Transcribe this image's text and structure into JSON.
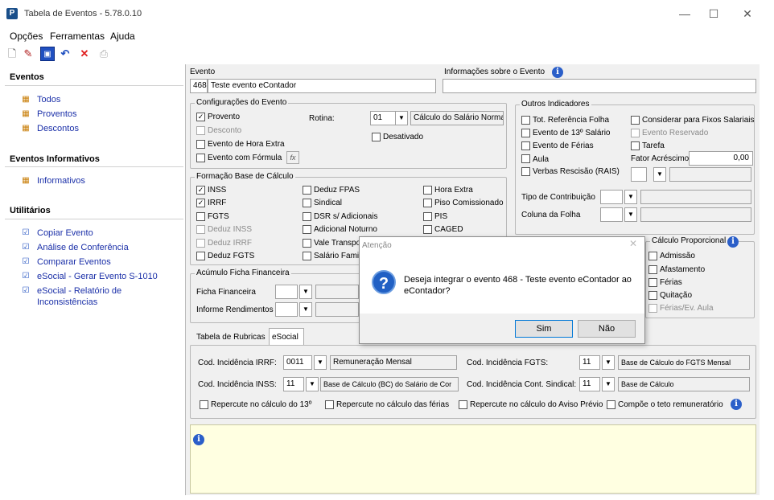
{
  "window": {
    "title": "Tabela de Eventos - 5.78.0.10",
    "minimize": "—",
    "maximize": "☐",
    "close": "✕"
  },
  "menu": [
    {
      "label": "Opções"
    },
    {
      "label": "Ferramentas"
    },
    {
      "label": "Ajuda"
    }
  ],
  "sidebar": {
    "eventos_title": "Eventos",
    "eventos": [
      "Todos",
      "Proventos",
      "Descontos"
    ],
    "informativos_title": "Eventos Informativos",
    "informativos": [
      "Informativos"
    ],
    "utilitarios_title": "Utilitários",
    "utilitarios": [
      "Copiar Evento",
      "Análise de Conferência",
      "Comparar Eventos",
      "eSocial - Gerar Evento S-1010",
      "eSocial - Relatório de",
      "Inconsistências"
    ]
  },
  "evento": {
    "label": "Evento",
    "code": "468",
    "name": "Teste evento eContador",
    "info_label": "Informações sobre o Evento",
    "info_value": ""
  },
  "config": {
    "title": "Configurações do Evento",
    "provento": "Provento",
    "desconto": "Desconto",
    "hora_extra": "Evento de Hora Extra",
    "formula": "Evento com Fórmula",
    "rotina_label": "Rotina:",
    "rotina_code": "01",
    "rotina_desc": "Cálculo do Salário Norma",
    "desativado": "Desativado",
    "fx": "fx"
  },
  "outros": {
    "title": "Outros Indicadores",
    "items": [
      "Tot. Referência Folha",
      "Evento de 13º Salário",
      "Evento de Férias",
      "Aula",
      "Verbas Rescisão (RAIS)"
    ],
    "right": [
      "Considerar para Fixos Salariais",
      "Evento Reservado",
      "Tarefa"
    ],
    "fator_label": "Fator Acréscimo",
    "fator_value": "0,00",
    "tipo_contrib": "Tipo de Contribuição",
    "coluna_folha": "Coluna da Folha"
  },
  "formacao": {
    "title": "Formação Base de Cálculo",
    "col1": [
      "INSS",
      "IRRF",
      "FGTS",
      "Deduz INSS",
      "Deduz IRRF",
      "Deduz FGTS"
    ],
    "col2": [
      "Deduz FPAS",
      "Sindical",
      "DSR s/ Adicionais",
      "Adicional Noturno",
      "Vale Transpo",
      "Salário Famil"
    ],
    "col3": [
      "Hora Extra",
      "Piso Comissionado",
      "PIS",
      "CAGED"
    ]
  },
  "acumulo": {
    "title": "Acúmulo Ficha Financeira",
    "ficha": "Ficha Financeira",
    "informe": "Informe Rendimentos"
  },
  "proporcional": {
    "title": "Cálculo Proporcional",
    "items": [
      "Admissão",
      "Afastamento",
      "Férias",
      "Quitação",
      "Férias/Ev. Aula"
    ]
  },
  "tabs": [
    "Tabela de Rubricas",
    "eSocial"
  ],
  "esocial": {
    "irrf_label": "Cod. Incidência IRRF:",
    "irrf_code": "0011",
    "irrf_desc": "Remuneração Mensal",
    "inss_label": "Cod. Incidência INSS:",
    "inss_code": "11",
    "inss_desc": "Base de Cálculo (BC) do Salário de Cor",
    "fgts_label": "Cod. Incidência FGTS:",
    "fgts_code": "11",
    "fgts_desc": "Base de Cálculo do FGTS Mensal",
    "sind_label": "Cod. Incidência Cont. Sindical:",
    "sind_code": "11",
    "sind_desc": "Base de Cálculo",
    "checks": [
      "Repercute no cálculo do 13º",
      "Repercute no cálculo das férias",
      "Repercute no cálculo do Aviso Prévio",
      "Compõe o teto remuneratório"
    ]
  },
  "dialog": {
    "title": "Atenção",
    "message1": "Deseja integrar o evento 468 - Teste evento eContador ao",
    "message2": "eContador?",
    "yes": "Sim",
    "no": "Não"
  }
}
